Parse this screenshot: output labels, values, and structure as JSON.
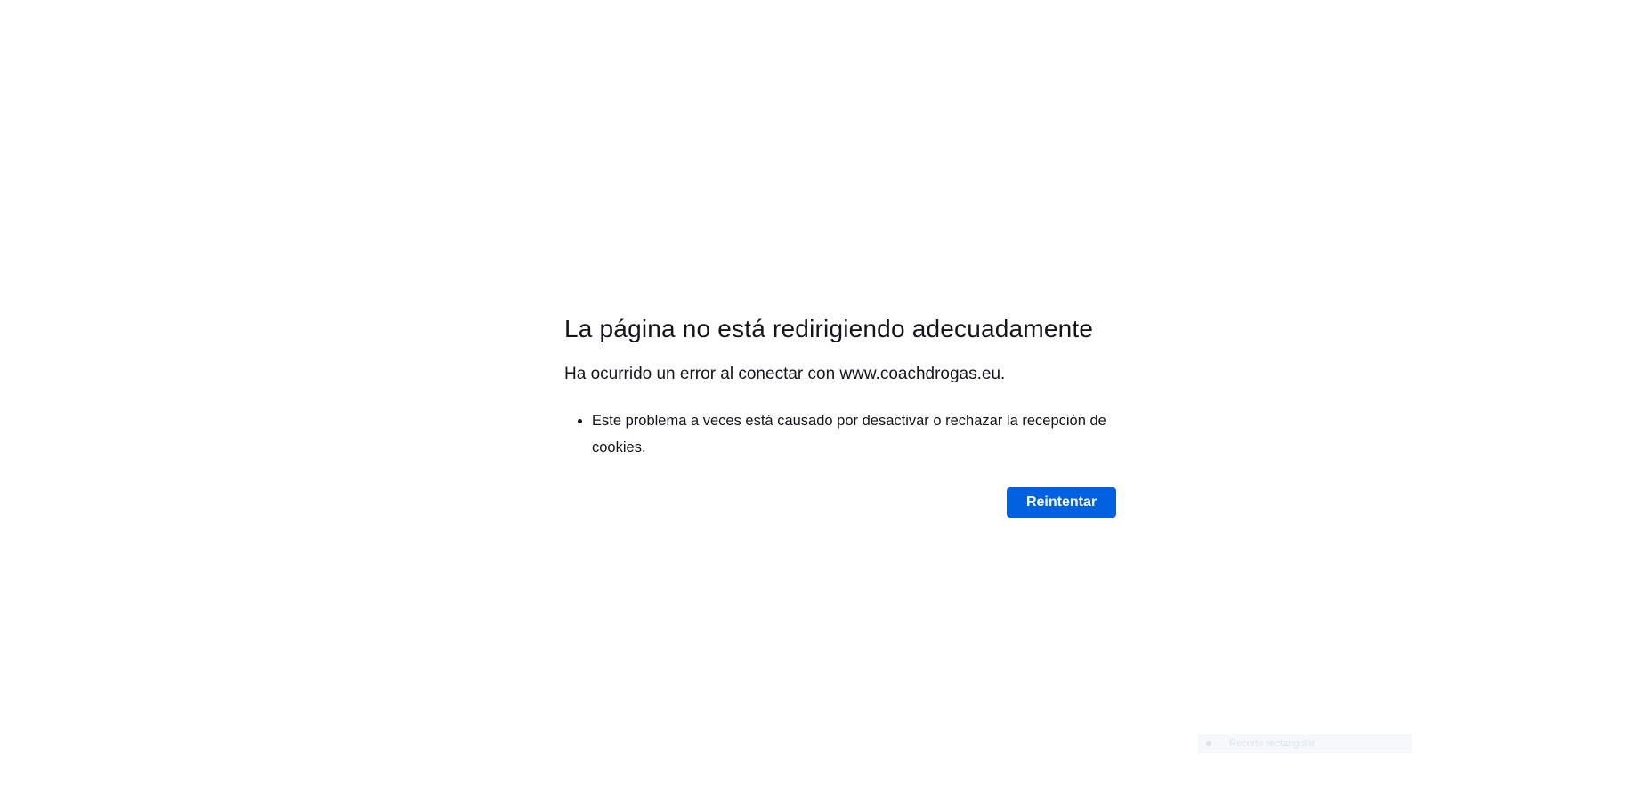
{
  "error": {
    "title": "La página no está redirigiendo adecuadamente",
    "short_description": "Ha ocurrido un error al conectar con www.coachdrogas.eu.",
    "reasons": [
      "Este problema a veces está causado por desactivar o rechazar la recepción de cookies."
    ],
    "retry_label": "Reintentar"
  },
  "overlay": {
    "tooltip_label": "Recorte rectangular"
  },
  "colors": {
    "primary_button": "#0061e0",
    "text": "#15141a",
    "background": "#ffffff"
  }
}
